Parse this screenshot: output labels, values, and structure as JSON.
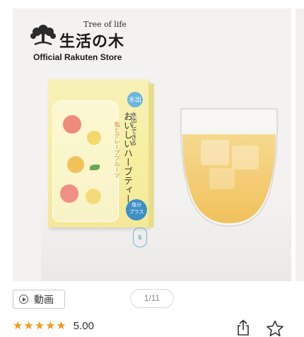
{
  "brand": {
    "tagline": "Tree of life",
    "name_jp": "生活の木",
    "store": "Official Rakuten Store"
  },
  "product_box": {
    "title": "おいしいハーブティー",
    "subtitle": "塩とグレープフルーツ",
    "catch": "水出しできる",
    "water_badge": "水出し",
    "salt_badge_line1": "塩分",
    "salt_badge_line2": "プラス",
    "count": "6"
  },
  "controls": {
    "video_label": "動画",
    "pager": "1/11"
  },
  "rating": {
    "stars": 5,
    "value": "5.00"
  },
  "colors": {
    "star": "#f29b1b",
    "box_yellow": "#f6ef9f",
    "tea": "#f2c867"
  },
  "icons": {
    "video": "play-circle-icon",
    "share": "share-icon",
    "favorite": "star-outline-icon"
  }
}
